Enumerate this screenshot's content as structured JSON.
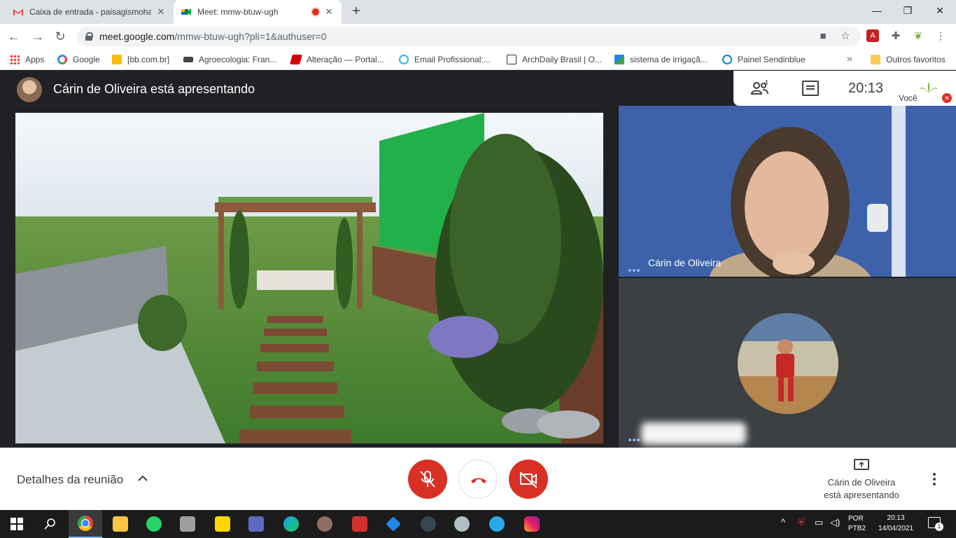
{
  "browser": {
    "tabs": [
      {
        "title": "Caixa de entrada - paisagismoha",
        "favicon": "gmail-icon"
      },
      {
        "title": "Meet: mmw-btuw-ugh",
        "favicon": "meet-icon",
        "recording": true
      }
    ],
    "url_host": "meet.google.com",
    "url_path": "/mmw-btuw-ugh?pli=1&authuser=0",
    "bookmarks": [
      {
        "label": "Apps",
        "icon": "apps-grid-icon"
      },
      {
        "label": "Google",
        "icon": "google-icon"
      },
      {
        "label": "[bb.com.br]",
        "icon": "bb-icon"
      },
      {
        "label": "Agroecologia: Fran...",
        "icon": "agro-icon"
      },
      {
        "label": "Alteração — Portal...",
        "icon": "portal-icon"
      },
      {
        "label": "Email Profissional:...",
        "icon": "email-icon"
      },
      {
        "label": "ArchDaily Brasil | O...",
        "icon": "archdaily-icon"
      },
      {
        "label": "sistema de irrigaçã...",
        "icon": "irrigacao-icon"
      },
      {
        "label": "Painel Sendinblue",
        "icon": "sendinblue-icon"
      }
    ],
    "other_bookmarks": "Outros favoritos",
    "more_bookmarks": "»"
  },
  "meet": {
    "presenting_banner": "Cárin de Oliveira está apresentando",
    "people_count": "4",
    "clock": "20:13",
    "self_label": "Você",
    "participant_name": "Cárin de Oliveira",
    "meeting_details": "Detalhes da reunião",
    "presenting_line1": "Cárin de Oliveira",
    "presenting_line2": "está apresentando"
  },
  "taskbar": {
    "lang_line1": "POR",
    "lang_line2": "PTB2",
    "time": "20:13",
    "date": "14/04/2021",
    "notification_count": "1"
  },
  "colors": {
    "meet_red": "#d93025",
    "meet_dark": "#202124",
    "accent_blue": "#8ab4f8"
  }
}
